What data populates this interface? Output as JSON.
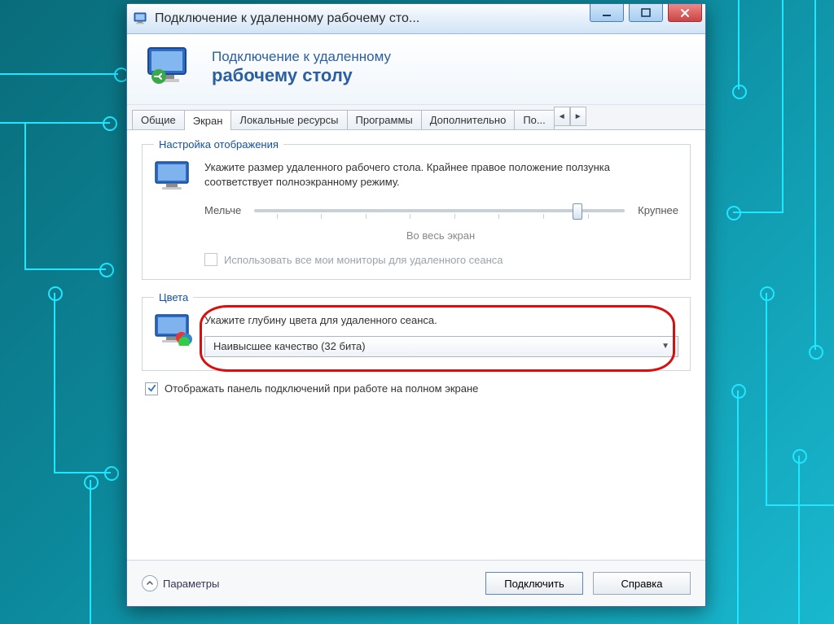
{
  "window": {
    "title": "Подключение к удаленному рабочему сто..."
  },
  "header": {
    "line1": "Подключение к удаленному",
    "line2": "рабочему столу"
  },
  "tabs": {
    "items": [
      {
        "label": "Общие"
      },
      {
        "label": "Экран"
      },
      {
        "label": "Локальные ресурсы"
      },
      {
        "label": "Программы"
      },
      {
        "label": "Дополнительно"
      },
      {
        "label": "По..."
      }
    ],
    "active_index": 1
  },
  "display_group": {
    "legend": "Настройка отображения",
    "description": "Укажите размер удаленного рабочего стола. Крайнее правое положение ползунка соответствует полноэкранному режиму.",
    "slider_min_label": "Мельче",
    "slider_max_label": "Крупнее",
    "slider_value_label": "Во весь экран",
    "use_all_monitors_label": "Использовать все мои мониторы для удаленного сеанса"
  },
  "colors_group": {
    "legend": "Цвета",
    "description": "Укажите глубину цвета для удаленного сеанса.",
    "selected": "Наивысшее качество (32 бита)"
  },
  "connection_bar_checkbox": {
    "label": "Отображать панель подключений при работе на полном экране",
    "checked": true
  },
  "footer": {
    "params_label": "Параметры",
    "connect_label": "Подключить",
    "help_label": "Справка"
  }
}
